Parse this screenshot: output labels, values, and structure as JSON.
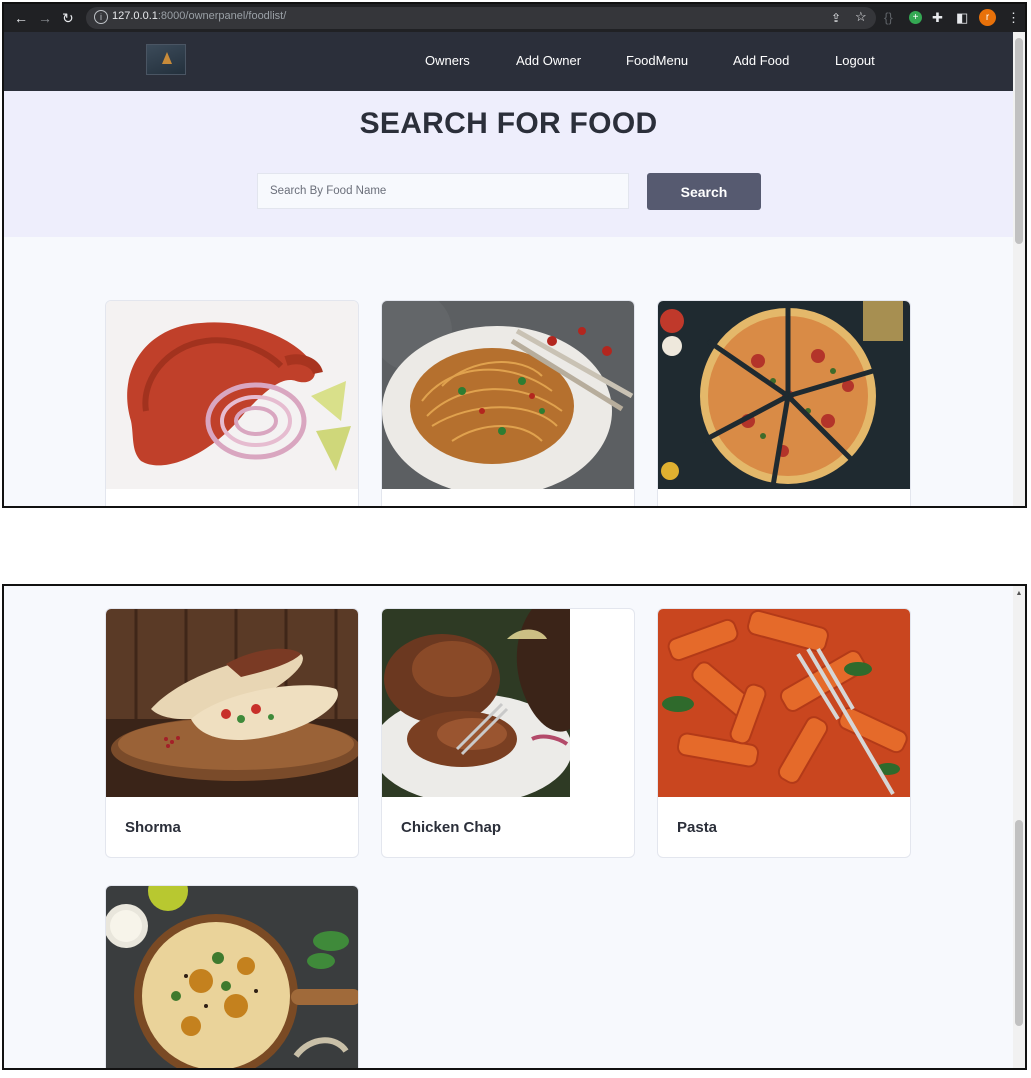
{
  "browser": {
    "url_host": "127.0.0.1",
    "url_rest": ":8000/ownerpanel/foodlist/",
    "avatar_letter": "r"
  },
  "nav": {
    "links": [
      "Owners",
      "Add Owner",
      "FoodMenu",
      "Add Food",
      "Logout"
    ]
  },
  "hero": {
    "title": "SEARCH FOR FOOD",
    "search_placeholder": "Search By Food Name",
    "search_button": "Search"
  },
  "foods_top": [
    {
      "name": "",
      "icon": "tandoori-chicken-image"
    },
    {
      "name": "",
      "icon": "spaghetti-image"
    },
    {
      "name": "",
      "icon": "pizza-image"
    }
  ],
  "foods": [
    {
      "name": "Shorma",
      "icon": "shawarma-image"
    },
    {
      "name": "Chicken Chap",
      "icon": "chicken-chap-image"
    },
    {
      "name": "Pasta",
      "icon": "penne-pasta-image"
    },
    {
      "name": "",
      "icon": "biryani-image"
    }
  ],
  "colors": {
    "nav_bg": "#2b2f3a",
    "hero_bg": "#eeeefc",
    "button_bg": "#565a70",
    "page_bg": "#f7f9fd"
  }
}
